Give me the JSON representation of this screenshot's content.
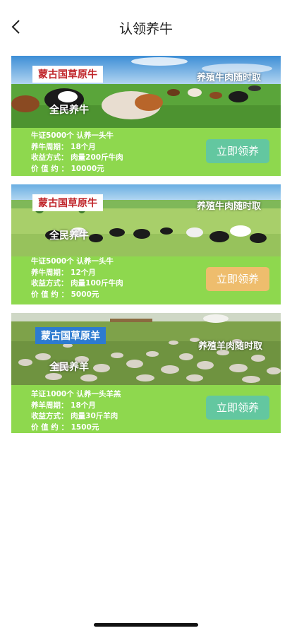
{
  "header": {
    "title": "认领养牛"
  },
  "cards": [
    {
      "badge": "蒙古国草原牛",
      "slogan": "养殖牛肉随时取",
      "tag": "全民养牛",
      "lines": [
        "牛证5000个 认养一头牛",
        "养牛周期： 18个月",
        "收益方式： 肉量200斤牛肉",
        "价 值 约 ： 10000元"
      ],
      "button_label": "立即领养",
      "button_color": "#63c7a0"
    },
    {
      "badge": "蒙古国草原牛",
      "slogan": "养殖牛肉随时取",
      "tag": "全民养牛",
      "lines": [
        "牛证5000个 认养一头牛",
        "养牛周期： 12个月",
        "收益方式： 肉量100斤牛肉",
        "价 值 约 ： 5000元"
      ],
      "button_label": "立即领养",
      "button_color": "#eebd6d"
    },
    {
      "badge": "蒙古国草原羊",
      "slogan": "养殖羊肉随时取",
      "tag": "全民养羊",
      "lines": [
        "羊证1000个 认养一头羊羔",
        "养羊周期： 18个月",
        "收益方式： 肉量30斤羊肉",
        "价 值 约 ： 1500元"
      ],
      "button_label": "立即领养",
      "button_color": "#63c7a0"
    }
  ],
  "colors": {
    "card_bg": "#8ed84e",
    "badge_red": "#c0252a",
    "badge_blue": "#2d7bd0"
  }
}
